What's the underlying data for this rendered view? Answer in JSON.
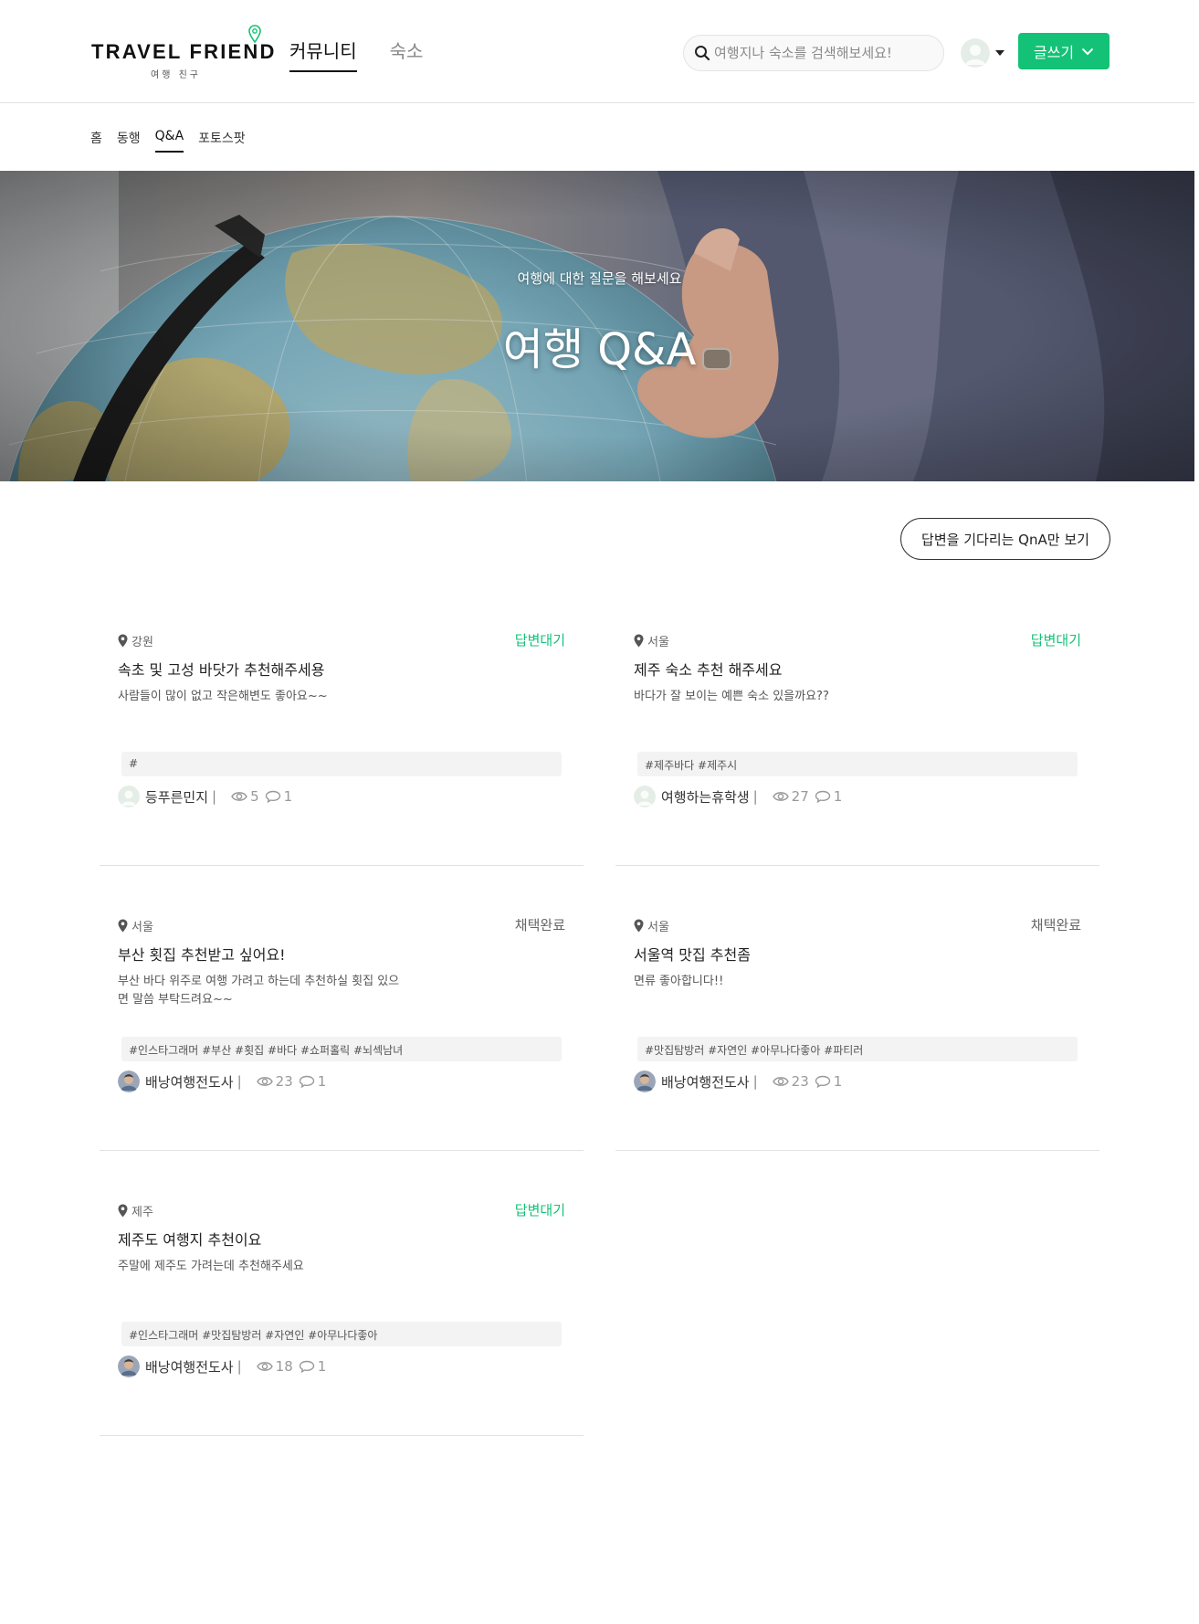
{
  "header": {
    "logo_text": "TRAVEL FRIEND",
    "logo_sub": "여행 친구",
    "nav": [
      {
        "label": "커뮤니티",
        "active": true
      },
      {
        "label": "숙소",
        "active": false
      }
    ],
    "search_placeholder": "여행지나 숙소를 검색해보세요!",
    "write_label": "글쓰기"
  },
  "subnav": [
    {
      "label": "홈",
      "active": false
    },
    {
      "label": "동행",
      "active": false
    },
    {
      "label": "Q&A",
      "active": true
    },
    {
      "label": "포토스팟",
      "active": false
    }
  ],
  "hero": {
    "subtitle": "여행에 대한 질문을 해보세요",
    "title": "여행 Q&A"
  },
  "filter_label": "답변을 기다리는 QnA만 보기",
  "colors": {
    "accent": "#13c276",
    "text": "#222222",
    "muted": "#999999",
    "tag_bg": "#f3f3f3"
  },
  "posts": [
    {
      "location": "강원",
      "status": "답변대기",
      "status_type": "waiting",
      "title": "속초 및 고성 바닷가 추천해주세용",
      "body": "사람들이 많이 없고 작은해변도 좋아요~~",
      "tags": "#",
      "author": "등푸른민지",
      "avatar": "default",
      "views": "5",
      "comments": "1"
    },
    {
      "location": "서울",
      "status": "답변대기",
      "status_type": "waiting",
      "title": "제주 숙소 추천 해주세요",
      "body": "바다가 잘 보이는 예쁜 숙소 있을까요??",
      "tags": "#제주바다 #제주시",
      "author": "여행하는휴학생",
      "avatar": "default",
      "views": "27",
      "comments": "1"
    },
    {
      "location": "서울",
      "status": "채택완료",
      "status_type": "done",
      "title": "부산 횟집 추천받고 싶어요!",
      "body": "부산 바다 위주로 여행 가려고 하는데 추천하실 횟집 있으면 말씀 부탁드려요~~",
      "tags": "#인스타그래머 #부산 #횟집 #바다 #쇼퍼홀릭 #뇌섹남녀",
      "author": "배낭여행전도사",
      "avatar": "photo",
      "views": "23",
      "comments": "1"
    },
    {
      "location": "서울",
      "status": "채택완료",
      "status_type": "done",
      "title": "서울역 맛집 추천좀",
      "body": "면류 좋아합니다!!",
      "tags": "#맛집탐방러 #자연인 #아무나다좋아 #파티러",
      "author": "배낭여행전도사",
      "avatar": "photo",
      "views": "23",
      "comments": "1"
    },
    {
      "location": "제주",
      "status": "답변대기",
      "status_type": "waiting",
      "title": "제주도 여행지 추천이요",
      "body": "주말에 제주도 가려는데 추천해주세요",
      "tags": "#인스타그래머 #맛집탐방러 #자연인 #아무나다좋아",
      "author": "배낭여행전도사",
      "avatar": "photo",
      "views": "18",
      "comments": "1"
    }
  ]
}
